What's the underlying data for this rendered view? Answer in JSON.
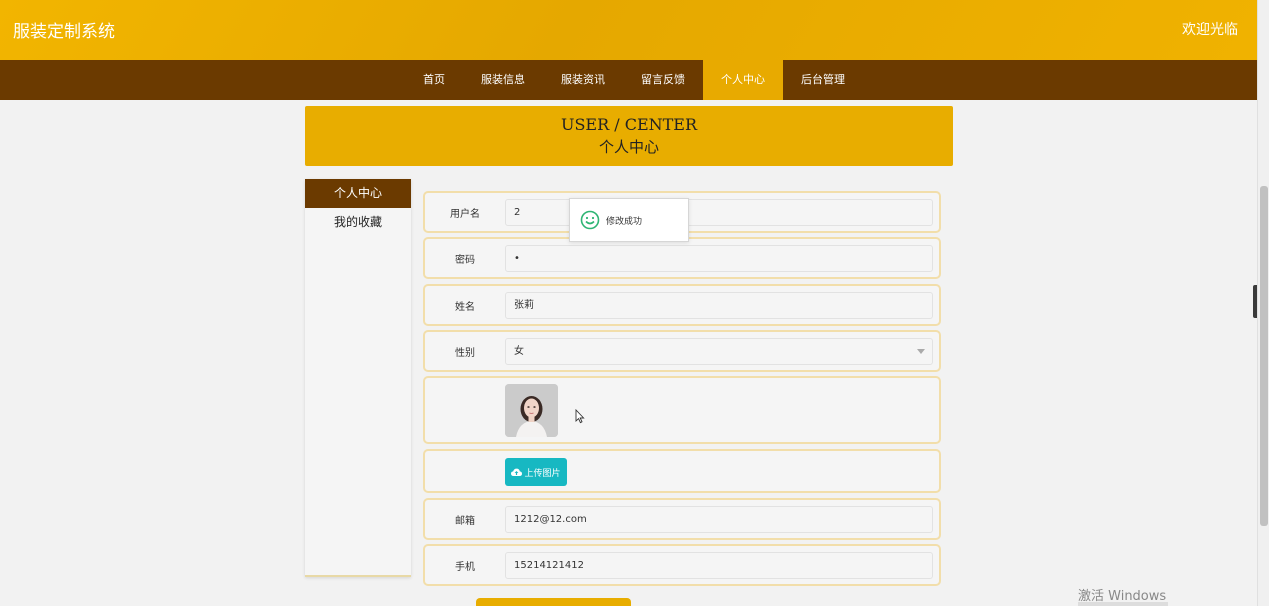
{
  "header": {
    "title": "服装定制系统",
    "welcome": "欢迎光临"
  },
  "nav": {
    "items": [
      "首页",
      "服装信息",
      "服装资讯",
      "留言反馈",
      "个人中心",
      "后台管理"
    ],
    "active_index": 4
  },
  "banner": {
    "en": "USER / CENTER",
    "cn": "个人中心"
  },
  "side_menu": {
    "items": [
      "个人中心",
      "我的收藏"
    ],
    "active_index": 0
  },
  "form": {
    "username": {
      "label": "用户名",
      "value": "2"
    },
    "password": {
      "label": "密码",
      "value": "•"
    },
    "name": {
      "label": "姓名",
      "value": "张莉"
    },
    "gender": {
      "label": "性别",
      "value": "女"
    },
    "upload": {
      "label": "上传图片"
    },
    "email": {
      "label": "邮箱",
      "value": "1212@12.com"
    },
    "phone": {
      "label": "手机",
      "value": "15214121412"
    }
  },
  "toast": {
    "message": "修改成功",
    "icon": "smile-icon"
  },
  "watermark": "激活 Windows",
  "colors": {
    "gold": "#e8ad00",
    "brown": "#6b3a00",
    "upload_teal": "#17b8c2"
  }
}
